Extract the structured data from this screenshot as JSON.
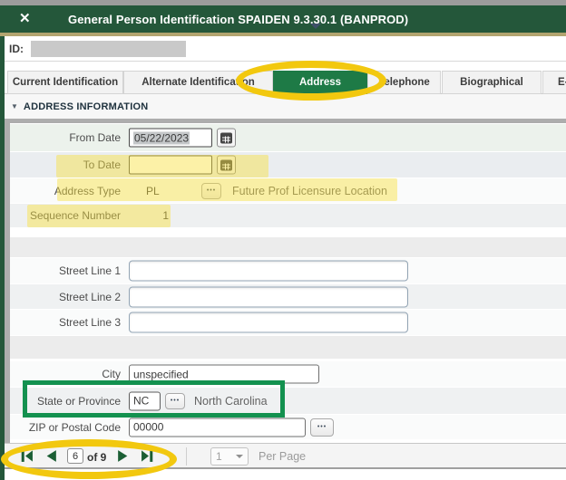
{
  "titlebar": {
    "title": "General Person Identification SPAIDEN 9.3.30.1 (BANPROD)"
  },
  "icons": {
    "close": "✕",
    "collapse": "▼",
    "lookup": "•••"
  },
  "id_row": {
    "label": "ID:"
  },
  "tabs": {
    "items": [
      {
        "label": "Current Identification",
        "active": false
      },
      {
        "label": "Alternate Identification",
        "active": false
      },
      {
        "label": "Address",
        "active": true
      },
      {
        "label": "Telephone",
        "active": false
      },
      {
        "label": "Biographical",
        "active": false
      },
      {
        "label": "E-",
        "active": false
      }
    ]
  },
  "section": {
    "title": "ADDRESS INFORMATION"
  },
  "form": {
    "from_date": {
      "label": "From Date",
      "value": "05/22/2023"
    },
    "to_date": {
      "label": "To Date",
      "value": ""
    },
    "address_type": {
      "label": "Address Type",
      "value": "PL",
      "description": "Future Prof Licensure Location"
    },
    "sequence_number": {
      "label": "Sequence Number",
      "value": "1"
    },
    "street_line_1": {
      "label": "Street Line 1",
      "value": ""
    },
    "street_line_2": {
      "label": "Street Line 2",
      "value": ""
    },
    "street_line_3": {
      "label": "Street Line 3",
      "value": ""
    },
    "city": {
      "label": "City",
      "value": "unspecified"
    },
    "state": {
      "label": "State or Province",
      "value": "NC",
      "description": "North Carolina"
    },
    "zip": {
      "label": "ZIP or Postal Code",
      "value": "00000"
    }
  },
  "pagination": {
    "page": "6",
    "of_label": "of 9",
    "per_page_value": "1",
    "per_page_label": "Per Page"
  },
  "colors": {
    "header_green": "#24573a",
    "active_tab_green": "#1e7a46",
    "gold_line": "#b2a46f",
    "nav_icon_green": "#1b5e34",
    "annotation_yellow": "#f2c80f",
    "annotation_highlight": "rgba(249,224,60,0.45)",
    "annotation_green": "#13914f"
  }
}
